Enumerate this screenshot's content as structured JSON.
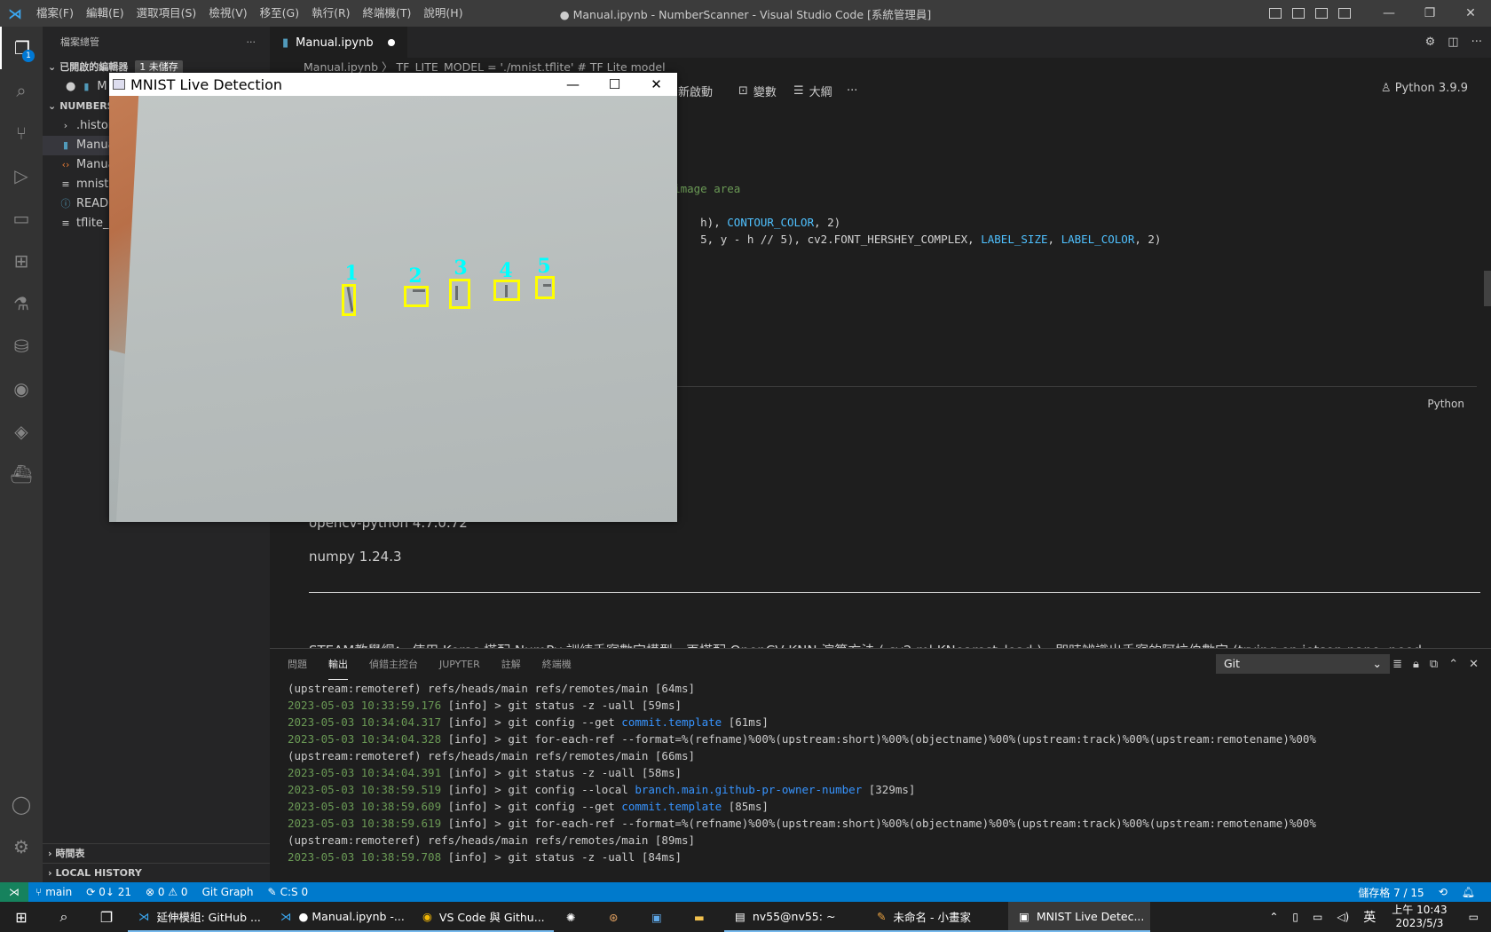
{
  "titlebar": {
    "menu": [
      "檔案(F)",
      "編輯(E)",
      "選取項目(S)",
      "檢視(V)",
      "移至(G)",
      "執行(R)",
      "終端機(T)",
      "說明(H)"
    ],
    "title": "● Manual.ipynb - NumberScanner - Visual Studio Code [系統管理員]"
  },
  "activitybar": {
    "explorer_badge": "1"
  },
  "sidebar": {
    "header": "檔案總管",
    "open_editors": "已開啟的編輯器",
    "unsaved": "1 未儲存",
    "open_file": "M",
    "project": "NUMBERS",
    "items": [
      ".history",
      "Manua",
      "Manua",
      "mnist.t",
      "READM",
      "tflite_ru"
    ],
    "timeline": "時間表",
    "local_history": "LOCAL HISTORY"
  },
  "editor": {
    "tab": "Manual.ipynb",
    "breadcrumb": "Manual.ipynb 〉 TF_LITE_MODEL = './mnist.tflite'  # TF Lite model",
    "toolbar": {
      "restart": "新啟動",
      "variables": "變數",
      "outline": "大綱",
      "more": "···"
    },
    "kernel": "Python 3.9.9",
    "code": {
      "line1_comment": "e image area",
      "line2_a": "h), ",
      "line2_const": "CONTOUR_COLOR",
      "line2_b": ", 2)",
      "line3_a": "5, y - h // 5), cv2.FONT_HERSHEY_COMPLEX, ",
      "line3_c1": "LABEL_SIZE",
      "line3_sep": ", ",
      "line3_c2": "LABEL_COLOR",
      "line3_b": ", 2)"
    },
    "cell_language": "Python",
    "md_opencv": "opencv-python 4.7.0.72",
    "md_numpy": "numpy 1.24.3",
    "md_steam": "STEAM教學網： 使用 Keras 搭配 NumPy 訓練手寫數字模型，再搭配 OpenCV KNN 演算方法 ( cv2.ml.KNearest_load )，即時辨識出手寫的阿拉伯數字 (trying on jetson nano, need"
  },
  "panel": {
    "tabs": [
      "問題",
      "輸出",
      "偵錯主控台",
      "JUPYTER",
      "註解",
      "終端機"
    ],
    "active_tab": "輸出",
    "output_channel": "Git",
    "log": [
      {
        "ts": "",
        "text": "(upstream:remoteref) refs/heads/main refs/remotes/main [64ms]",
        "link": "",
        "tail": ""
      },
      {
        "ts": "2023-05-03 10:33:59.176",
        "text": " [info] > git status -z -uall [59ms]",
        "link": "",
        "tail": ""
      },
      {
        "ts": "2023-05-03 10:34:04.317",
        "text": " [info] > git config --get ",
        "link": "commit.template",
        "tail": " [61ms]"
      },
      {
        "ts": "2023-05-03 10:34:04.328",
        "text": " [info] > git for-each-ref --format=%(refname)%00%(upstream:short)%00%(objectname)%00%(upstream:track)%00%(upstream:remotename)%00%",
        "link": "",
        "tail": ""
      },
      {
        "ts": "",
        "text": "(upstream:remoteref) refs/heads/main refs/remotes/main [66ms]",
        "link": "",
        "tail": ""
      },
      {
        "ts": "2023-05-03 10:34:04.391",
        "text": " [info] > git status -z -uall [58ms]",
        "link": "",
        "tail": ""
      },
      {
        "ts": "2023-05-03 10:38:59.519",
        "text": " [info] > git config --local ",
        "link": "branch.main.github-pr-owner-number",
        "tail": " [329ms]"
      },
      {
        "ts": "2023-05-03 10:38:59.609",
        "text": " [info] > git config --get ",
        "link": "commit.template",
        "tail": " [85ms]"
      },
      {
        "ts": "2023-05-03 10:38:59.619",
        "text": " [info] > git for-each-ref --format=%(refname)%00%(upstream:short)%00%(objectname)%00%(upstream:track)%00%(upstream:remotename)%00%",
        "link": "",
        "tail": ""
      },
      {
        "ts": "",
        "text": "(upstream:remoteref) refs/heads/main refs/remotes/main [89ms]",
        "link": "",
        "tail": ""
      },
      {
        "ts": "2023-05-03 10:38:59.708",
        "text": " [info] > git status -z -uall [84ms]",
        "link": "",
        "tail": ""
      }
    ]
  },
  "statusbar": {
    "branch": "main",
    "sync": "0↓ 21",
    "errors": "⊗ 0 ⚠ 0",
    "git_graph": "Git Graph",
    "cs": "C:S 0",
    "cell": "儲存格 7 / 15"
  },
  "taskbar": {
    "tasks": [
      "延伸模組: GitHub ...",
      "● Manual.ipynb -...",
      "VS Code 與 Githu...",
      "nv55@nv55: ~",
      "未命名 - 小畫家",
      "MNIST Live Detec..."
    ],
    "ime": "英",
    "time": "上午 10:43",
    "date": "2023/5/3"
  },
  "mnist_window": {
    "title": "MNIST Live Detection",
    "detections": [
      {
        "label": "1"
      },
      {
        "label": "2"
      },
      {
        "label": "3"
      },
      {
        "label": "4"
      },
      {
        "label": "5"
      }
    ]
  }
}
